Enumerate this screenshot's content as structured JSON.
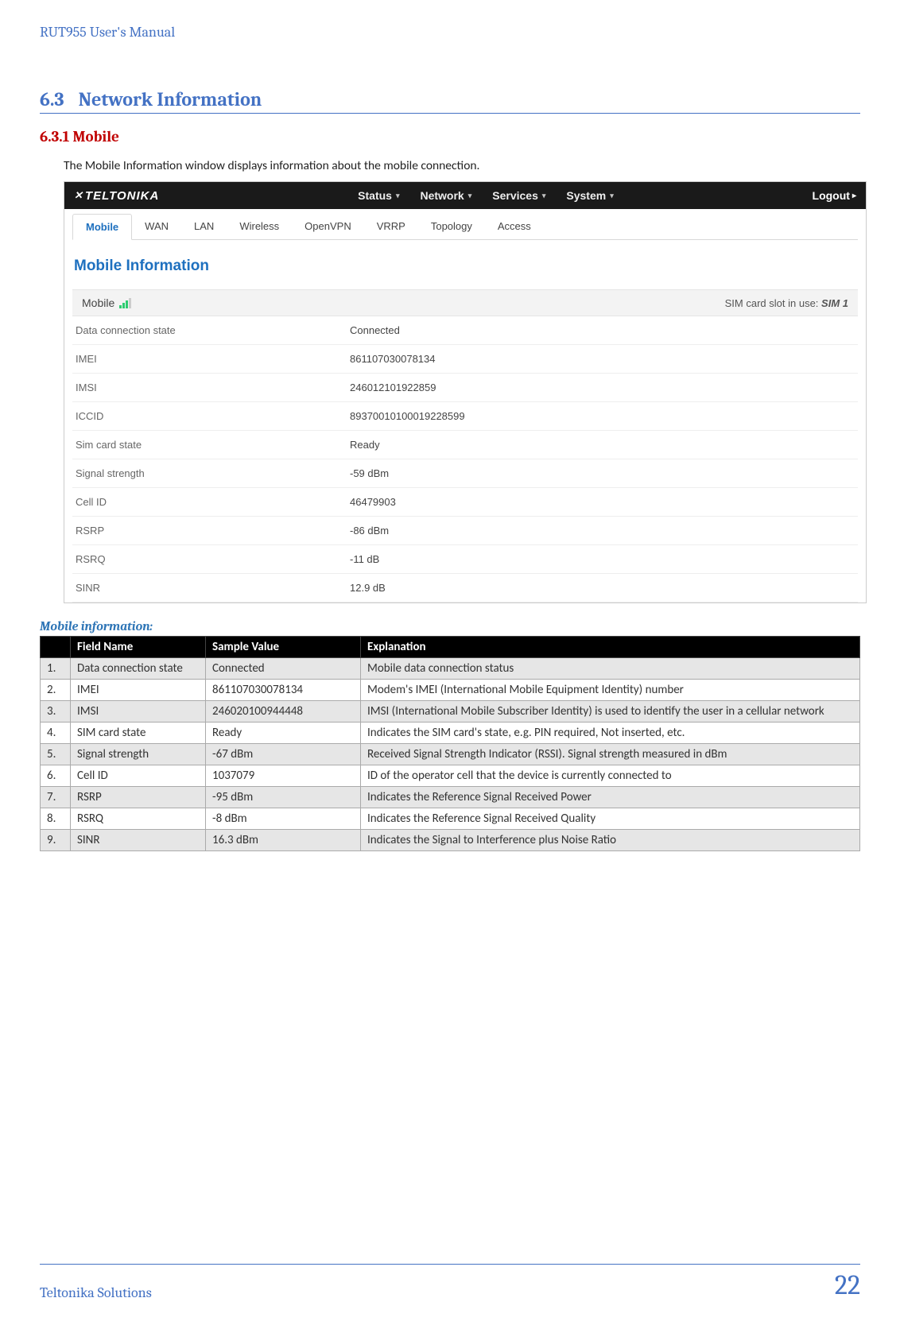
{
  "doc": {
    "header": "RUT955 User's Manual",
    "section_number": "6.3",
    "section_title": "Network Information",
    "subsection": "6.3.1 Mobile",
    "intro": "The Mobile Information window displays information about the mobile connection.",
    "caption": "Mobile information:",
    "footer_left": "Teltonika Solutions",
    "page_number": "22"
  },
  "app": {
    "brand": "TELTONIKA",
    "nav": {
      "status": "Status",
      "network": "Network",
      "services": "Services",
      "system": "System"
    },
    "logout": "Logout",
    "tabs": {
      "mobile": "Mobile",
      "wan": "WAN",
      "lan": "LAN",
      "wireless": "Wireless",
      "openvpn": "OpenVPN",
      "vrrp": "VRRP",
      "topology": "Topology",
      "access": "Access"
    },
    "page_title": "Mobile Information",
    "panel_label": "Mobile",
    "sim_note_prefix": "SIM card slot in use: ",
    "sim_note_value": "SIM 1",
    "rows": {
      "dcs": {
        "k": "Data connection state",
        "v": "Connected"
      },
      "imei": {
        "k": "IMEI",
        "v": "861107030078134"
      },
      "imsi": {
        "k": "IMSI",
        "v": "246012101922859"
      },
      "iccid": {
        "k": "ICCID",
        "v": "89370010100019228599"
      },
      "sim": {
        "k": "Sim card state",
        "v": "Ready"
      },
      "sig": {
        "k": "Signal strength",
        "v": "-59 dBm"
      },
      "cell": {
        "k": "Cell ID",
        "v": "46479903"
      },
      "rsrp": {
        "k": "RSRP",
        "v": "-86 dBm"
      },
      "rsrq": {
        "k": "RSRQ",
        "v": "-11 dB"
      },
      "sinr": {
        "k": "SINR",
        "v": "12.9 dB"
      }
    }
  },
  "ref": {
    "headers": {
      "num": "",
      "field": "Field Name",
      "sample": "Sample  Value",
      "explanation": "Explanation"
    },
    "rows": [
      {
        "n": "1.",
        "f": "Data connection state",
        "s": "Connected",
        "e": "Mobile data connection status"
      },
      {
        "n": "2.",
        "f": "IMEI",
        "s": "861107030078134",
        "e": "Modem's IMEI (International Mobile Equipment Identity) number"
      },
      {
        "n": "3.",
        "f": "IMSI",
        "s": "246020100944448",
        "e": "IMSI (International Mobile Subscriber Identity) is used to identify the user in a cellular network"
      },
      {
        "n": "4.",
        "f": "SIM card state",
        "s": "Ready",
        "e": "Indicates the SIM card's state, e.g. PIN required, Not inserted, etc."
      },
      {
        "n": "5.",
        "f": "Signal strength",
        "s": "-67 dBm",
        "e": "Received Signal Strength Indicator (RSSI). Signal strength measured in dBm"
      },
      {
        "n": "6.",
        "f": "Cell ID",
        "s": "1037079",
        "e": "ID of the operator cell that the device is currently connected to"
      },
      {
        "n": "7.",
        "f": "RSRP",
        "s": "-95 dBm",
        "e": "Indicates the Reference Signal Received Power"
      },
      {
        "n": "8.",
        "f": "RSRQ",
        "s": "-8 dBm",
        "e": "Indicates the Reference Signal Received Quality"
      },
      {
        "n": "9.",
        "f": "SINR",
        "s": "16.3 dBm",
        "e": "Indicates the Signal to Interference plus Noise Ratio"
      }
    ]
  }
}
